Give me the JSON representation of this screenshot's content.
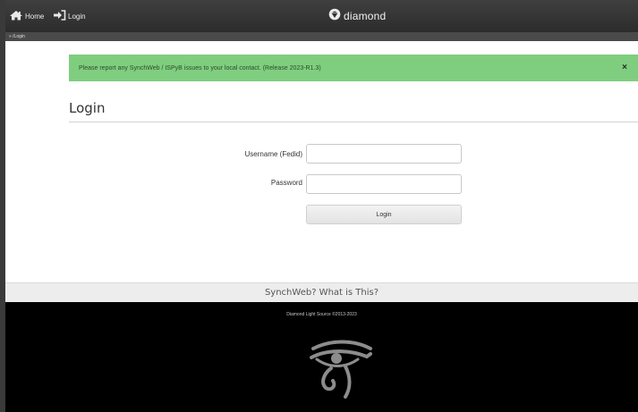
{
  "nav": {
    "home_label": "Home",
    "login_label": "Login",
    "brand": "diamond",
    "icons": [
      "home-icon",
      "sign-in-icon",
      "diamond-logo-icon"
    ]
  },
  "breadcrumb": "» /Login",
  "notice": {
    "message": "Please report any SynchWeb / ISPyB issues to your local contact. (Release 2023-R1.3)",
    "close_label": "×",
    "color": "#7fce7f"
  },
  "page": {
    "title": "Login"
  },
  "form": {
    "username_label": "Username (Fedid)",
    "username_value": "",
    "password_label": "Password",
    "password_value": "",
    "submit_label": "Login"
  },
  "links": {
    "about": "SynchWeb? What is This?"
  },
  "footer": {
    "copyright": "Diamond Light Source ©2013-2023",
    "logo_icon": "eye-of-horus-icon"
  }
}
